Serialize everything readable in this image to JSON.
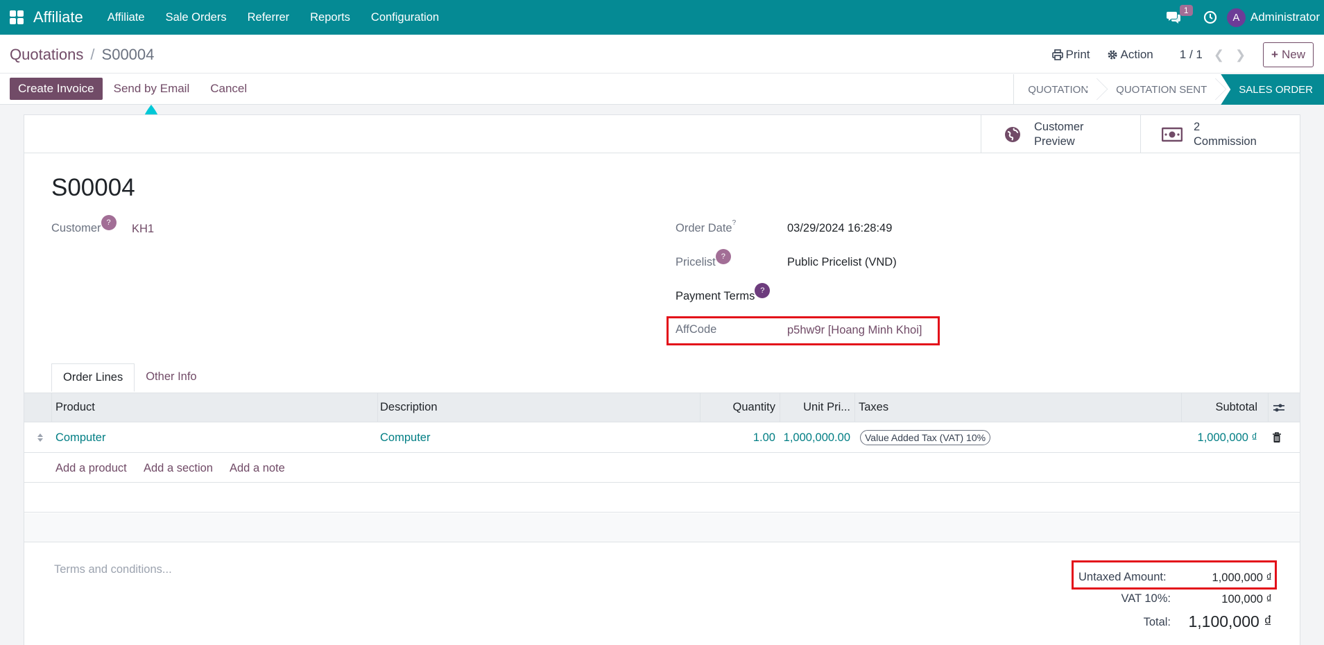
{
  "navbar": {
    "app_name": "Affiliate",
    "menu": [
      "Affiliate",
      "Sale Orders",
      "Referrer",
      "Reports",
      "Configuration"
    ],
    "chat_badge": "1",
    "avatar_initial": "A",
    "username": "Administrator"
  },
  "breadcrumb": {
    "parent": "Quotations",
    "separator": "/",
    "current": "S00004"
  },
  "control": {
    "print_label": "Print",
    "action_label": "Action",
    "pager": "1 / 1",
    "new_label": "New"
  },
  "actions": {
    "create_invoice": "Create Invoice",
    "send_email": "Send by Email",
    "cancel": "Cancel"
  },
  "statusbar": [
    "QUOTATION",
    "QUOTATION SENT",
    "SALES ORDER"
  ],
  "smart_buttons": {
    "preview_line1": "Customer",
    "preview_line2": "Preview",
    "commission_count": "2",
    "commission_label": "Commission"
  },
  "form": {
    "name": "S00004",
    "customer_label": "Customer",
    "customer_value": "KH1",
    "order_date_label": "Order Date",
    "order_date_value": "03/29/2024 16:28:49",
    "pricelist_label": "Pricelist",
    "pricelist_value": "Public Pricelist (VND)",
    "payment_terms_label": "Payment Terms",
    "affcode_label": "AffCode",
    "affcode_value": "p5hw9r [Hoang Minh Khoi]",
    "help_mark": "?",
    "sup_mark": "?"
  },
  "tabs": [
    "Order Lines",
    "Other Info"
  ],
  "table": {
    "columns": [
      "Product",
      "Description",
      "Quantity",
      "Unit Pri...",
      "Taxes",
      "Subtotal"
    ],
    "rows": [
      {
        "product": "Computer",
        "description": "Computer",
        "quantity": "1.00",
        "unit_price": "1,000,000.00",
        "tax": "Value Added Tax (VAT) 10%",
        "subtotal": "1,000,000 ₫"
      }
    ],
    "add_product": "Add a product",
    "add_section": "Add a section",
    "add_note": "Add a note"
  },
  "terms_placeholder": "Terms and conditions...",
  "totals": {
    "untaxed_label": "Untaxed Amount:",
    "untaxed_value": "1,000,000 ₫",
    "vat_label": "VAT 10%:",
    "vat_value": "100,000 ₫",
    "total_label": "Total:",
    "total_value": "1,100,000 ₫"
  },
  "colors": {
    "navbar": "#058a94",
    "primary": "#714b67",
    "highlight": "#e3101a",
    "link_teal": "#017e84"
  }
}
